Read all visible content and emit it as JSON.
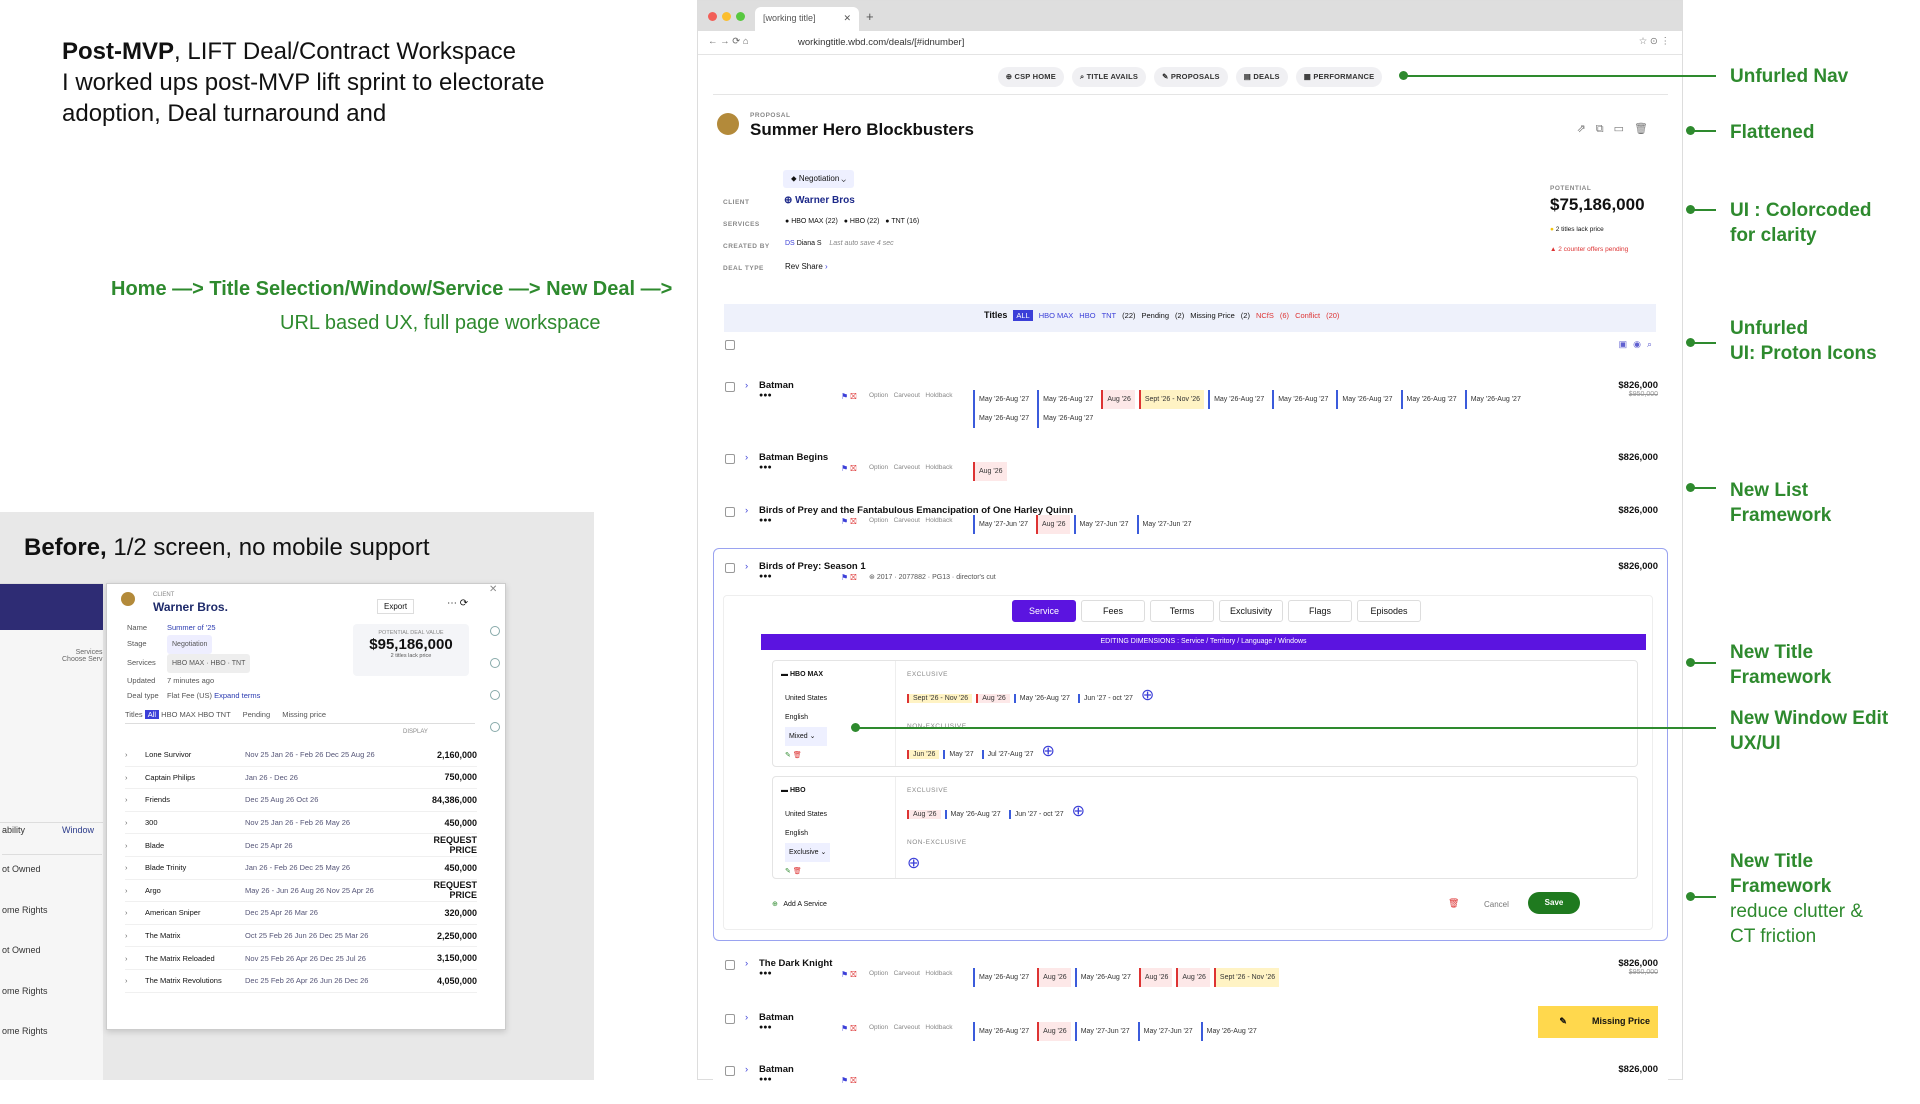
{
  "intro": {
    "bold": "Post-MVP",
    "rest": ", LIFT Deal/Contract Workspace",
    "line2": "I worked ups post-MVP lift sprint to electorate",
    "line3": "adoption, Deal turnaround and"
  },
  "flow": {
    "line1": "Home —> Title Selection/Window/Service —> New Deal —>",
    "line2": "URL based UX, full page workspace"
  },
  "before": {
    "bold": "Before,",
    "rest": " 1/2 screen, no mobile support",
    "left_rows": [
      "ability",
      "Window",
      "ot Owned",
      "ome Rights",
      "ot Owned",
      "ome Rights",
      "ome Rights"
    ],
    "left_services": "Services",
    "left_choose": "Choose Serv",
    "panel": {
      "client_lbl": "CLIENT",
      "client": "Warner Bros.",
      "export": "Export",
      "name_lbl": "Name",
      "name": "Summer of '25",
      "stage_lbl": "Stage",
      "stage": "Negotiation",
      "services_lbl": "Services",
      "updated_lbl": "Updated",
      "updated": "7 minutes ago",
      "dealtype_lbl": "Deal type",
      "dealtype": "Flat Fee (US)",
      "expand": "Expand terms",
      "potential_lbl": "POTENTIAL DEAL VALUE",
      "potential": "$95,186,000",
      "lack": "2 titles lack price",
      "tabs": [
        "Titles",
        "All",
        "HBO MAX",
        "HBO",
        "TNT",
        "Pending",
        "Missing price"
      ],
      "display": "DISPLAY",
      "rows": [
        {
          "n": "Lone Survivor",
          "d": "Nov 25  Jan 26 - Feb 26  Dec 25  Aug 26",
          "v": "2,160,000"
        },
        {
          "n": "Captain Philips",
          "d": "Jan 26 - Dec 26",
          "v": "750,000"
        },
        {
          "n": "Friends",
          "d": "Dec 25  Aug 26  Oct 26",
          "v": "84,386,000"
        },
        {
          "n": "300",
          "d": "Nov 25  Jan 26 - Feb 26  May 26",
          "v": "450,000"
        },
        {
          "n": "Blade",
          "d": "Dec 25  Apr 26",
          "v": "REQUEST PRICE"
        },
        {
          "n": "Blade Trinity",
          "d": "Jan 26 - Feb 26  Dec 25  May 26",
          "v": "450,000"
        },
        {
          "n": "Argo",
          "d": "May 26 - Jun 26  Aug 26  Nov 25  Apr 26",
          "v": "REQUEST PRICE"
        },
        {
          "n": "American Sniper",
          "d": "Dec 25  Apr 26  Mar 26",
          "v": "320,000"
        },
        {
          "n": "The Matrix",
          "d": "Oct 25  Feb 26  Jun 26  Dec 25  Mar 26",
          "v": "2,250,000"
        },
        {
          "n": "The Matrix Reloaded",
          "d": "Nov 25  Feb 26  Apr 26  Dec 25  Jul 26",
          "v": "3,150,000"
        },
        {
          "n": "The Matrix Revolutions",
          "d": "Dec 25  Feb 26  Apr 26  Jun 26  Dec 26",
          "v": "4,050,000"
        }
      ]
    }
  },
  "browser": {
    "tab": "[working title]",
    "url": "workingtitle.wbd.com/deals/[#idnumber]",
    "nav": [
      "CSP HOME",
      "TITLE AVAILS",
      "PROPOSALS",
      "DEALS",
      "PERFORMANCE"
    ]
  },
  "deal": {
    "kind": "PROPOSAL",
    "title": "Summer Hero Blockbusters",
    "stage": "Negotiation",
    "client_lbl": "CLIENT",
    "client": "Warner Bros",
    "services_lbl": "SERVICES",
    "services": [
      "HBO MAX (22)",
      "HBO (22)",
      "TNT (16)"
    ],
    "created_lbl": "CREATED BY",
    "created": "Diana S",
    "autosave": "Last auto save 4 sec",
    "dealtype_lbl": "DEAL TYPE",
    "dealtype": "Rev Share",
    "potential_lbl": "POTENTIAL",
    "potential": "$75,186,000",
    "warn1": "2 titles lack price",
    "warn2": "2 counter offers pending",
    "filters": [
      "Titles",
      "ALL",
      "HBO MAX",
      "HBO",
      "TNT",
      "(22)",
      "Pending",
      "(2)",
      "Missing Price",
      "(2)",
      "NCfS",
      "(6)",
      "Conflict",
      "(20)"
    ],
    "opt": [
      "Option",
      "Carveout",
      "Holdback"
    ],
    "titles": [
      {
        "name": "Batman",
        "price": "$826,000",
        "old": "$950,000",
        "chips": [
          "May '26-Aug '27",
          "May '26-Aug '27",
          "Aug '26",
          "Sept '26 - Nov '26",
          "May '26-Aug '27",
          "May '26-Aug '27",
          "May '26-Aug '27",
          "May '26-Aug '27",
          "May '26-Aug '27",
          "May '26-Aug '27",
          "May '26-Aug '27"
        ]
      },
      {
        "name": "Batman Begins",
        "price": "$826,000",
        "chips": [
          "Aug '26"
        ]
      },
      {
        "name": "Birds of Prey and the Fantabulous Emancipation of One Harley Quinn",
        "price": "$826,000",
        "chips": [
          "May '27-Jun '27",
          "Aug '26",
          "May '27-Jun '27",
          "May '27-Jun '27"
        ]
      },
      {
        "name": "Birds of Prey: Season 1",
        "price": "$826,000",
        "meta": "2017 · 2077882 · PG13 · director's cut"
      }
    ],
    "edit": {
      "tabs": [
        "Service",
        "Fees",
        "Terms",
        "Exclusivity",
        "Flags",
        "Episodes"
      ],
      "banner": "EDITING DIMENSIONS : Service / Territory / Language / Windows",
      "svc1": {
        "name": "HBO MAX",
        "territory": "United States",
        "language": "English",
        "mode": "Mixed",
        "excl_lbl": "EXCLUSIVE",
        "excl": [
          "Sept '26 - Nov '26",
          "Aug '26",
          "May '26-Aug '27",
          "Jun '27 - oct '27"
        ],
        "nonex_lbl": "NON-EXCLUSIVE",
        "nonex": [
          "Jun '26",
          "May '27",
          "Jul '27-Aug '27"
        ]
      },
      "svc2": {
        "name": "HBO",
        "territory": "United States",
        "language": "English",
        "mode": "Exclusive",
        "excl_lbl": "EXCLUSIVE",
        "excl": [
          "Aug '26",
          "May '26-Aug '27",
          "Jun '27 - oct '27"
        ],
        "nonex_lbl": "NON-EXCLUSIVE"
      },
      "add": "Add A Service",
      "cancel": "Cancel",
      "save": "Save"
    },
    "bottom": [
      {
        "name": "The Dark Knight",
        "price": "$826,000",
        "old": "$950,000",
        "chips": [
          "May '26-Aug '27",
          "Aug '26",
          "May '26-Aug '27",
          "Aug '26",
          "Aug '26",
          "Sept '26 - Nov '26"
        ]
      },
      {
        "name": "Batman",
        "missing": "Missing Price",
        "chips": [
          "May '26-Aug '27",
          "Aug '26",
          "May '27-Jun '27",
          "May '27-Jun '27",
          "May '26-Aug '27"
        ]
      },
      {
        "name": "Batman",
        "price": "$826,000"
      }
    ]
  },
  "annotations": {
    "a1": "Unfurled Nav",
    "a2": "Flattened",
    "a3a": "UI : Colorcoded",
    "a3b": "for clarity",
    "a4a": "Unfurled",
    "a4b": "UI: Proton Icons",
    "a5a": "New List",
    "a5b": "Framework",
    "a6a": "New Title",
    "a6b": "Framework",
    "a7a": "New Window Edit",
    "a7b": "UX/UI",
    "a8a": "New Title",
    "a8b": "Framework",
    "a8c": "reduce clutter &",
    "a8d": "CT friction"
  }
}
